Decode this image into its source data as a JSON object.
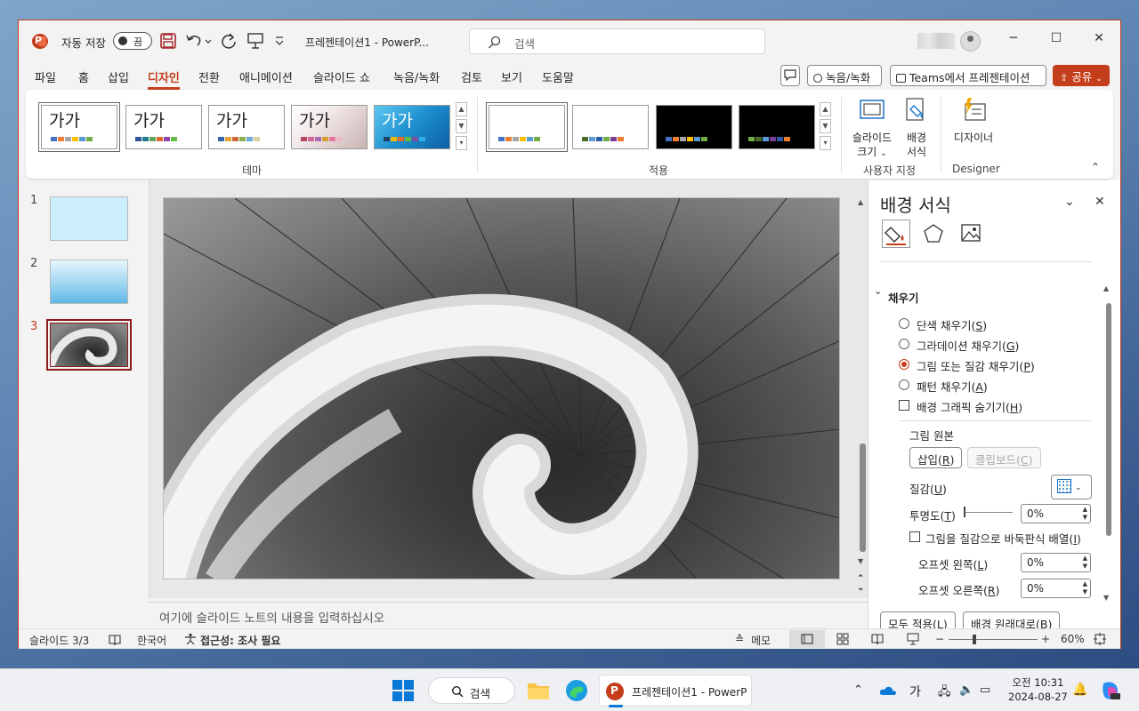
{
  "titlebar": {
    "autosave_label": "자동 저장",
    "autosave_state": "끔",
    "doc_title": "프레젠테이션1  -  PowerP...",
    "search_placeholder": "검색"
  },
  "menu_tabs": [
    "파일",
    "홈",
    "삽입",
    "디자인",
    "전환",
    "애니메이션",
    "슬라이드 쇼",
    "녹음/녹화",
    "검토",
    "보기",
    "도움말"
  ],
  "active_tab": "디자인",
  "tab_right": {
    "record": "녹음/녹화",
    "teams": "Teams에서 프레젠테이션",
    "share": "공유"
  },
  "ribbon": {
    "theme_sample": "가가",
    "themes_group_label": "테마",
    "variants_group_label": "적용",
    "slide_size_label_1": "슬라이드",
    "slide_size_label_2": "크기",
    "format_bg_label_1": "배경",
    "format_bg_label_2": "서식",
    "customize_group_label": "사용자 지정",
    "designer_label": "디자이너",
    "designer_group_label": "Designer"
  },
  "slides": {
    "numbers": [
      "1",
      "2",
      "3"
    ]
  },
  "notes_placeholder": "여기에 슬라이드 노트의 내용을 입력하십시오",
  "format_pane": {
    "title": "배경 서식",
    "section_fill": "채우기",
    "options": {
      "solid": "단색 채우기(",
      "solid_key": "S",
      "gradient": "그라데이션 채우기(",
      "gradient_key": "G",
      "picture": "그림 또는 질감 채우기(",
      "picture_key": "P",
      "pattern": "패턴 채우기(",
      "pattern_key": "A",
      "hide_graphics": "배경 그래픽 숨기기(",
      "hide_graphics_key": "H"
    },
    "picture_source_label": "그림 원본",
    "insert_button": "삽입(",
    "insert_key": "R",
    "clipboard_button": "클립보드(",
    "clipboard_key": "C",
    "texture_label": "질감(",
    "texture_key": "U",
    "transparency_label": "투명도(",
    "transparency_key": "T",
    "transparency_value": "0%",
    "tile_label": "그림을 질감으로 바둑판식 배열(",
    "tile_key": "I",
    "offset_left_label": "오프셋 왼쪽(",
    "offset_left_key": "L",
    "offset_left_value": "0%",
    "offset_right_label": "오프셋 오른쪽(",
    "offset_right_key": "R",
    "offset_right_value": "0%",
    "apply_all_button": "모두 적용(",
    "apply_all_key": "L",
    "reset_button": "배경 원래대로(",
    "reset_key": "B",
    "close_paren": ")"
  },
  "statusbar": {
    "slide_count": "슬라이드 3/3",
    "language": "한국어",
    "accessibility": "접근성: 조사 필요",
    "notes": "메모",
    "zoom": "60%"
  },
  "taskbar": {
    "search": "검색",
    "ppt_window": "프레젠테이션1 - PowerP",
    "ime": "가",
    "time": "오전 10:31",
    "date": "2024-08-27"
  },
  "colors": {
    "accent": "#c43e1c",
    "slide_thumb_sel": "#8b1a1a"
  }
}
